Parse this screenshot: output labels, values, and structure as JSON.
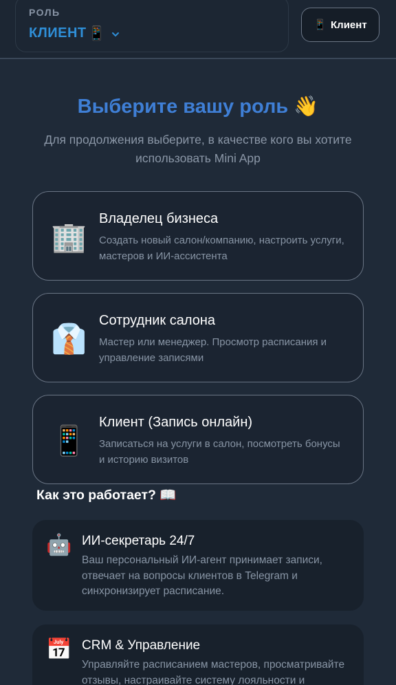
{
  "header": {
    "role_label": "РОЛЬ",
    "role_value": "КЛИЕНТ",
    "role_value_icon": "📱",
    "switch_button_icon": "📱",
    "switch_button_label": "Клиент"
  },
  "intro": {
    "title": "Выберите вашу роль 👋",
    "subtitle": "Для продолжения выберите, в качестве кого вы хотите использовать Mini App"
  },
  "roles": [
    {
      "icon": "🏢",
      "title": "Владелец бизнеса",
      "description": "Создать новый салон/компанию, настроить услуги, мастеров и ИИ-ассистента"
    },
    {
      "icon": "👔",
      "title": "Сотрудник салона",
      "description": "Мастер или менеджер. Просмотр расписания и управление записями"
    },
    {
      "icon": "📱",
      "title": "Клиент (Запись онлайн)",
      "description": "Записаться на услуги в салон, посмотреть бонусы и историю визитов"
    }
  ],
  "how_it_works": {
    "title": "Как это работает? 📖",
    "features": [
      {
        "icon": "🤖",
        "title": "ИИ-секретарь 24/7",
        "description": "Ваш персональный ИИ-агент принимает записи, отвечает на вопросы клиентов в Telegram и синхронизирует расписание."
      },
      {
        "icon": "📅",
        "title": "CRM & Управление",
        "description": "Управляйте расписанием мастеров, просматривайте отзывы, настраивайте систему лояльности и"
      }
    ]
  },
  "colors": {
    "background": "#1f2a38",
    "accent": "#2f8fd8",
    "title": "#3f7fd6",
    "card_border": "#6a7585",
    "muted_text": "#8895a5"
  }
}
